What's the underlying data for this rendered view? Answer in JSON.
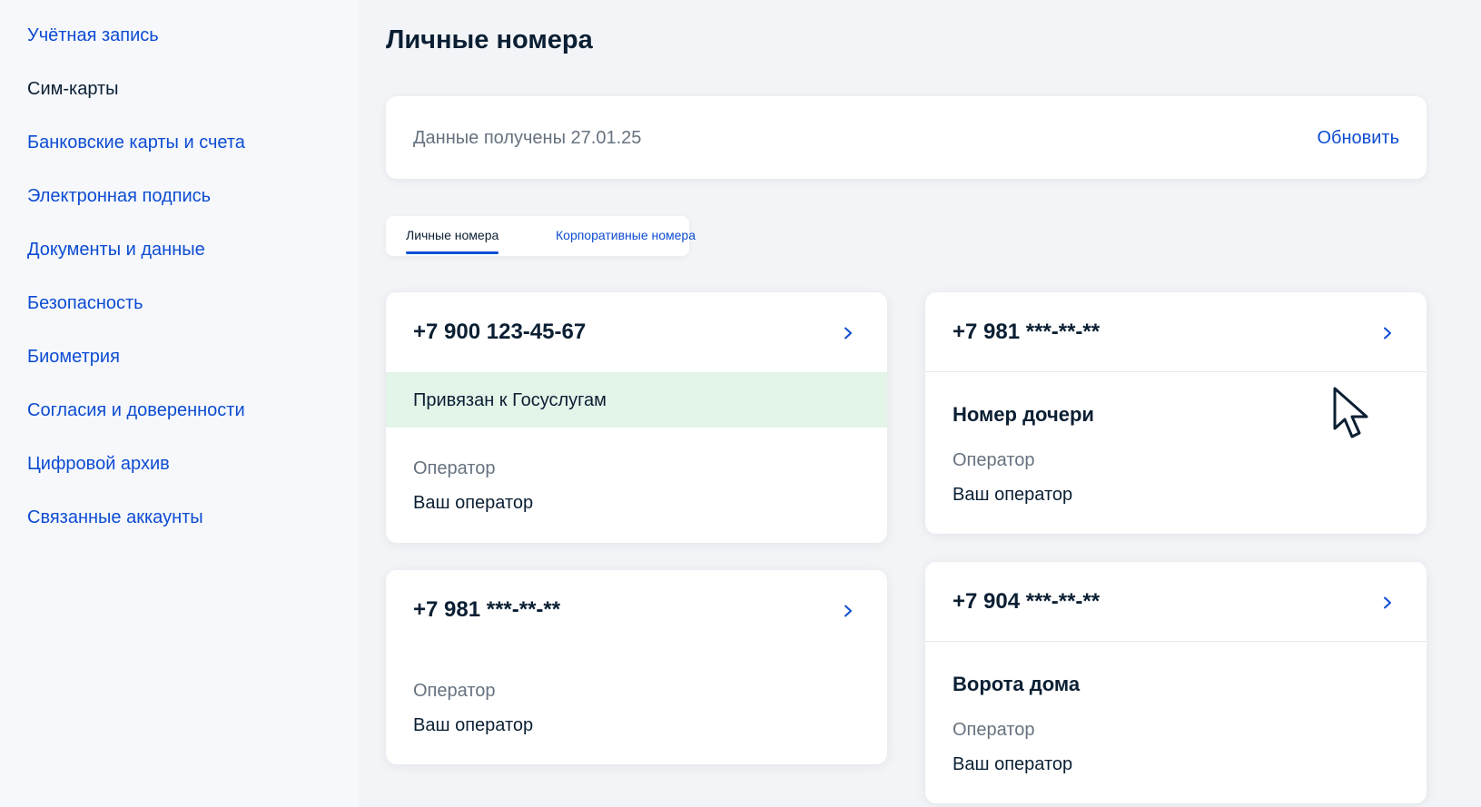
{
  "sidebar": {
    "items": [
      {
        "label": "Учётная запись"
      },
      {
        "label": "Сим-карты"
      },
      {
        "label": "Банковские карты и счета"
      },
      {
        "label": "Электронная подпись"
      },
      {
        "label": "Документы и данные"
      },
      {
        "label": "Безопасность"
      },
      {
        "label": "Биометрия"
      },
      {
        "label": "Согласия и доверенности"
      },
      {
        "label": "Цифровой архив"
      },
      {
        "label": "Связанные аккаунты"
      }
    ],
    "active_item": "Сим-карты"
  },
  "main": {
    "title": "Личные номера",
    "info": {
      "text": "Данные получены 27.01.25",
      "refresh_label": "Обновить"
    },
    "tabs": [
      {
        "label": "Личные номера",
        "selected": true
      },
      {
        "label": "Корпоративные номера",
        "selected": false
      }
    ],
    "cards": [
      {
        "number": "+7 900 123-45-67",
        "status": "Привязан к Госуслугам",
        "operator_label": "Оператор",
        "operator_value": "Ваш оператор"
      },
      {
        "number": "+7 981 ***-**-**",
        "name": "Номер дочери",
        "operator_label": "Оператор",
        "operator_value": "Ваш оператор"
      },
      {
        "number": "+7 981 ***-**-**",
        "operator_label": "Оператор",
        "operator_value": "Ваш оператор"
      },
      {
        "number": "+7 904 ***-**-**",
        "name": "Ворота дома",
        "operator_label": "Оператор",
        "operator_value": "Ваш оператор"
      }
    ]
  },
  "colors": {
    "accent": "#0d4cd3",
    "text": "#0b1f33",
    "muted": "#66727f",
    "status_bg": "#e3f4e9",
    "page_bg": "#f2f4f7"
  },
  "icons": {
    "card_chevron": "chevron-right-icon",
    "pointer": "mouse-cursor-icon"
  }
}
